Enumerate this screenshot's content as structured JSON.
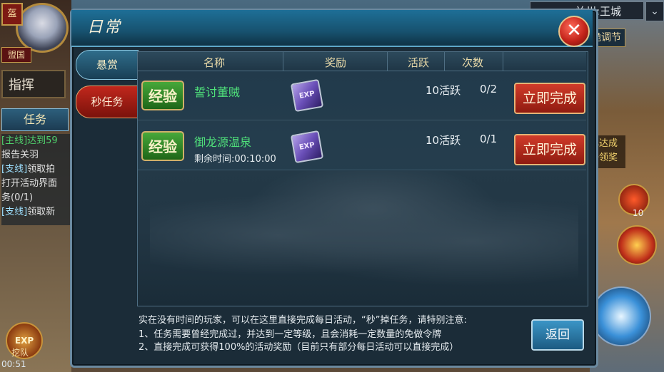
{
  "hud": {
    "badge": "盔",
    "guild": "盟国",
    "command": "指挥",
    "task_tab": "任务",
    "quests": [
      {
        "tag": "[主线]",
        "text": "达到59"
      },
      {
        "tag": "",
        "text": "报告关羽"
      },
      {
        "tag": "[支线]",
        "text": "领取拍"
      },
      {
        "tag": "",
        "text": "打开活动界面"
      },
      {
        "tag": "",
        "text": "务(0/1)"
      },
      {
        "tag": "[支线]",
        "text": "领取新"
      }
    ],
    "exp_icon": "EXP",
    "exp_caption": "挖队",
    "clock": "00:51",
    "map_name": "关州:王城",
    "map_toggle": "⌄",
    "event_button": "跪调节",
    "reward_notice": "已达成\n去领奖",
    "skill_count": "10"
  },
  "dialog": {
    "title": "日常",
    "close_icon": "✕",
    "tabs": [
      {
        "label": "悬赏"
      },
      {
        "label": "秒任务"
      }
    ],
    "columns": [
      "名称",
      "奖励",
      "活跃",
      "次数"
    ],
    "rows": [
      {
        "badge": "经验",
        "name": "誓讨董贼",
        "reward": "EXP",
        "remain": "",
        "active": "10活跃",
        "count": "0/2",
        "action": "立即完成"
      },
      {
        "badge": "经验",
        "name": "御龙源温泉",
        "reward": "EXP",
        "remain": "剩余时间:00:10:00",
        "active": "10活跃",
        "count": "0/1",
        "action": "立即完成"
      }
    ],
    "notes": [
      "实在没有时间的玩家，可以在这里直接完成每日活动，“秒”掉任务，请特别注意:",
      "1、任务需要曾经完成过，并达到一定等级，且会消耗一定数量的免做令牌",
      "2、直接完成可获得100%的活动奖励（目前只有部分每日活动可以直接完成）"
    ],
    "back_button": "返回"
  }
}
